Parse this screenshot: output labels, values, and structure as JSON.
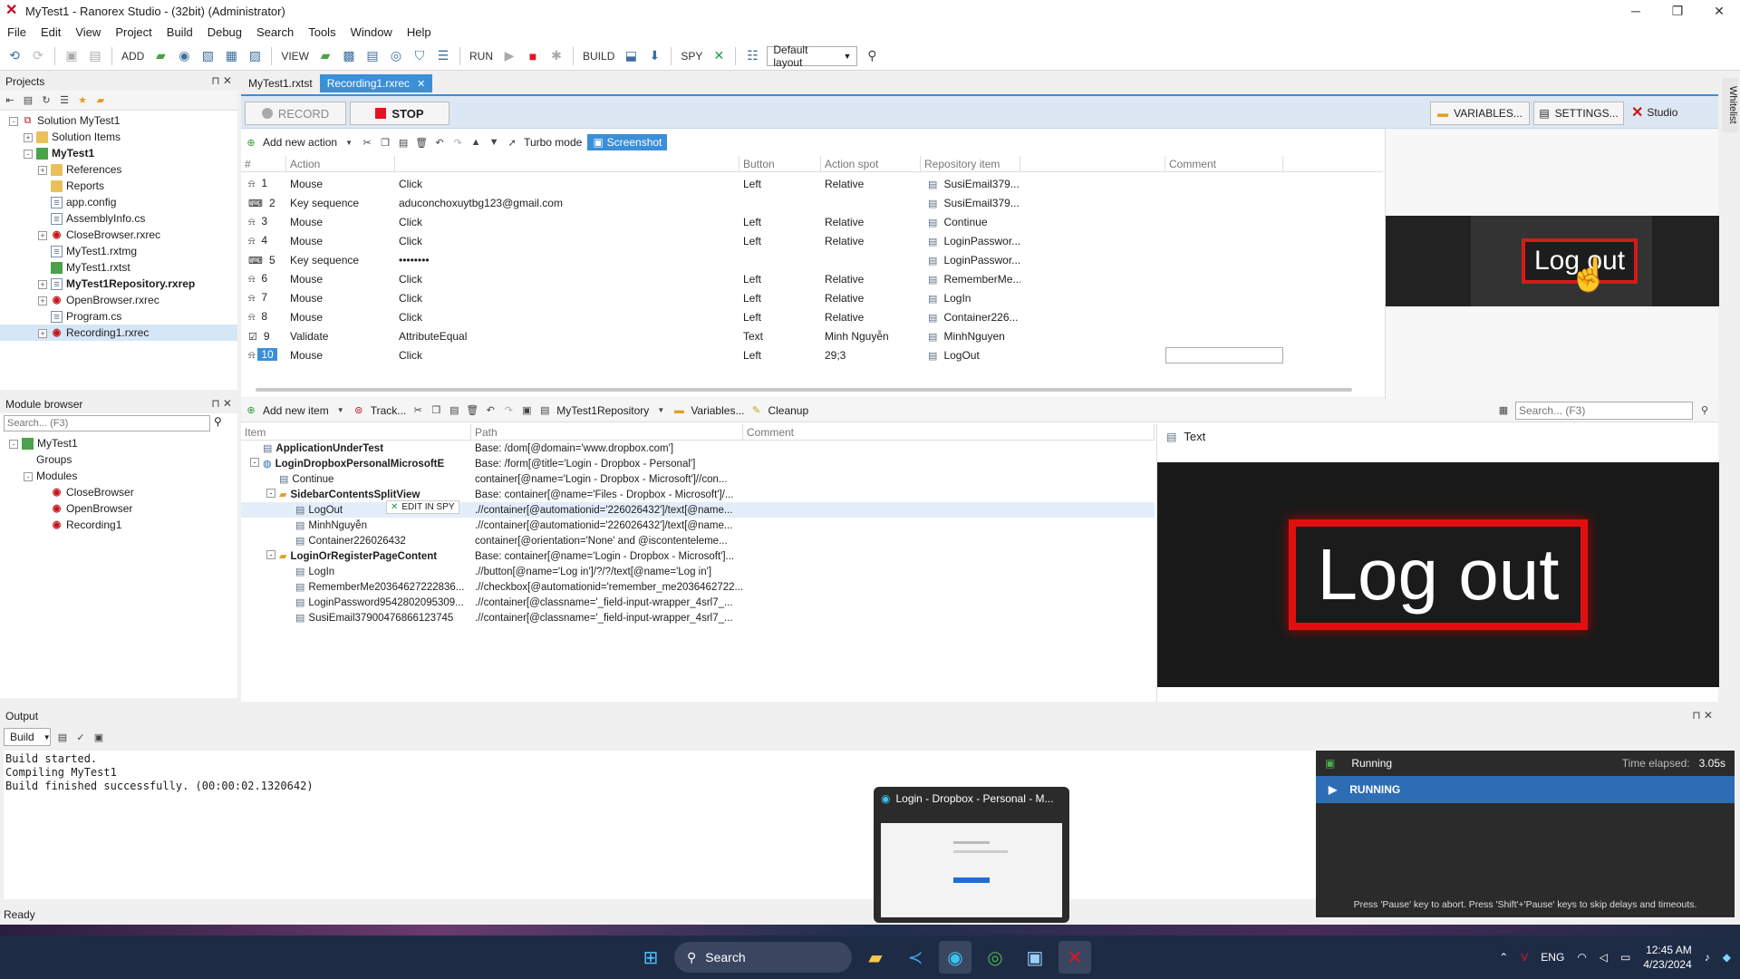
{
  "window": {
    "title": "MyTest1 - Ranorex Studio - (32bit) (Administrator)"
  },
  "menu": [
    "File",
    "Edit",
    "View",
    "Project",
    "Build",
    "Debug",
    "Search",
    "Tools",
    "Window",
    "Help"
  ],
  "toolbar": {
    "add": "ADD",
    "view": "VIEW",
    "run": "RUN",
    "build": "BUILD",
    "spy": "SPY",
    "layout": "Default layout"
  },
  "projects": {
    "title": "Projects",
    "items": [
      {
        "label": "Solution MyTest1",
        "indent": 0,
        "icon": "solution",
        "exp": "-"
      },
      {
        "label": "Solution Items",
        "indent": 1,
        "icon": "folder",
        "exp": "+"
      },
      {
        "label": "MyTest1",
        "indent": 1,
        "icon": "project",
        "exp": "-",
        "bold": true
      },
      {
        "label": "References",
        "indent": 2,
        "icon": "folder",
        "exp": "+"
      },
      {
        "label": "Reports",
        "indent": 2,
        "icon": "folder",
        "exp": ""
      },
      {
        "label": "app.config",
        "indent": 2,
        "icon": "file",
        "exp": ""
      },
      {
        "label": "AssemblyInfo.cs",
        "indent": 2,
        "icon": "file",
        "exp": ""
      },
      {
        "label": "CloseBrowser.rxrec",
        "indent": 2,
        "icon": "rec",
        "exp": "+"
      },
      {
        "label": "MyTest1.rxtmg",
        "indent": 2,
        "icon": "file",
        "exp": ""
      },
      {
        "label": "MyTest1.rxtst",
        "indent": 2,
        "icon": "project",
        "exp": ""
      },
      {
        "label": "MyTest1Repository.rxrep",
        "indent": 2,
        "icon": "file",
        "exp": "+",
        "bold": true
      },
      {
        "label": "OpenBrowser.rxrec",
        "indent": 2,
        "icon": "rec",
        "exp": "+"
      },
      {
        "label": "Program.cs",
        "indent": 2,
        "icon": "file",
        "exp": ""
      },
      {
        "label": "Recording1.rxrec",
        "indent": 2,
        "icon": "rec",
        "exp": "+",
        "selected": true
      }
    ]
  },
  "module_browser": {
    "title": "Module browser",
    "search_placeholder": "Search... (F3)",
    "items": [
      {
        "label": "MyTest1",
        "indent": 0,
        "icon": "project",
        "exp": "-"
      },
      {
        "label": "Groups",
        "indent": 1,
        "icon": "none",
        "exp": ""
      },
      {
        "label": "Modules",
        "indent": 1,
        "icon": "none",
        "exp": "-"
      },
      {
        "label": "CloseBrowser",
        "indent": 2,
        "icon": "rec",
        "exp": ""
      },
      {
        "label": "OpenBrowser",
        "indent": 2,
        "icon": "rec",
        "exp": ""
      },
      {
        "label": "Recording1",
        "indent": 2,
        "icon": "rec",
        "exp": ""
      }
    ]
  },
  "tabs": [
    {
      "label": "MyTest1.rxtst",
      "active": false
    },
    {
      "label": "Recording1.rxrec",
      "active": true
    }
  ],
  "recorder": {
    "record_label": "RECORD",
    "stop_label": "STOP",
    "variables_label": "VARIABLES...",
    "settings_label": "SETTINGS...",
    "studio_label": "Studio",
    "add_action": "Add new action",
    "turbo": "Turbo mode",
    "screenshot": "Screenshot",
    "columns": [
      "#",
      "Action",
      "",
      "Button",
      "Action spot",
      "Repository item",
      "",
      "Comment"
    ],
    "actions": [
      {
        "n": "1",
        "type": "Mouse",
        "action": "Click",
        "button": "Left",
        "spot": "Relative",
        "repo": "SusiEmail379..."
      },
      {
        "n": "2",
        "type": "Key sequence",
        "action": "aduconchoxuytbg123@gmail.com",
        "button": "",
        "spot": "",
        "repo": "SusiEmail379..."
      },
      {
        "n": "3",
        "type": "Mouse",
        "action": "Click",
        "button": "Left",
        "spot": "Relative",
        "repo": "Continue"
      },
      {
        "n": "4",
        "type": "Mouse",
        "action": "Click",
        "button": "Left",
        "spot": "Relative",
        "repo": "LoginPasswor..."
      },
      {
        "n": "5",
        "type": "Key sequence",
        "action": "••••••••",
        "button": "",
        "spot": "",
        "repo": "LoginPasswor..."
      },
      {
        "n": "6",
        "type": "Mouse",
        "action": "Click",
        "button": "Left",
        "spot": "Relative",
        "repo": "RememberMe..."
      },
      {
        "n": "7",
        "type": "Mouse",
        "action": "Click",
        "button": "Left",
        "spot": "Relative",
        "repo": "LogIn"
      },
      {
        "n": "8",
        "type": "Mouse",
        "action": "Click",
        "button": "Left",
        "spot": "Relative",
        "repo": "Container226..."
      },
      {
        "n": "9",
        "type": "Validate",
        "action": "AttributeEqual",
        "button": "Text",
        "spot": "Minh Nguyễn",
        "repo": "MinhNguyen"
      },
      {
        "n": "10",
        "type": "Mouse",
        "action": "Click",
        "button": "Left",
        "spot": "29;3",
        "repo": "LogOut",
        "selected": true
      }
    ],
    "preview_text": "Log out"
  },
  "repository": {
    "add_item": "Add new item",
    "track": "Track...",
    "repo_name": "MyTest1Repository",
    "variables": "Variables...",
    "cleanup": "Cleanup",
    "search_placeholder": "Search... (F3)",
    "preview_title": "Text",
    "preview_text": "Log out",
    "edit_in_spy": "EDIT IN SPY",
    "columns": [
      "Item",
      "Path",
      "Comment"
    ],
    "items": [
      {
        "label": "ApplicationUnderTest",
        "indent": 0,
        "bold": true,
        "exp": "",
        "path": "Base: /dom[@domain='www.dropbox.com']"
      },
      {
        "label": "LoginDropboxPersonalMicrosoftE",
        "indent": 0,
        "bold": true,
        "exp": "-",
        "path": "Base: /form[@title='Login - Dropbox - Personal']"
      },
      {
        "label": "Continue",
        "indent": 1,
        "exp": "",
        "path": "container[@name='Login - Dropbox - Microsoft']//con..."
      },
      {
        "label": "SidebarContentsSplitView",
        "indent": 1,
        "bold": true,
        "exp": "-",
        "path": "Base: container[@name='Files - Dropbox - Microsoft']/..."
      },
      {
        "label": "LogOut",
        "indent": 2,
        "exp": "",
        "path": ".//container[@automationid='226026432']/text[@name...",
        "selected": true
      },
      {
        "label": "MinhNguyễn",
        "indent": 2,
        "exp": "",
        "path": ".//container[@automationid='226026432']/text[@name..."
      },
      {
        "label": "Container226026432",
        "indent": 2,
        "exp": "",
        "path": "container[@orientation='None' and @iscontenteleme..."
      },
      {
        "label": "LoginOrRegisterPageContent",
        "indent": 1,
        "bold": true,
        "exp": "-",
        "path": "Base: container[@name='Login - Dropbox - Microsoft']..."
      },
      {
        "label": "LogIn",
        "indent": 2,
        "exp": "",
        "path": ".//button[@name='Log in']/?/?/text[@name='Log in']"
      },
      {
        "label": "RememberMe20364627222836...",
        "indent": 2,
        "exp": "",
        "path": ".//checkbox[@automationid='remember_me2036462722..."
      },
      {
        "label": "LoginPassword9542802095309...",
        "indent": 2,
        "exp": "",
        "path": ".//container[@classname='_field-input-wrapper_4srl7_..."
      },
      {
        "label": "SusiEmail37900476866123745",
        "indent": 2,
        "exp": "",
        "path": ".//container[@classname='_field-input-wrapper_4srl7_..."
      }
    ]
  },
  "output": {
    "title": "Output",
    "source": "Build",
    "lines": [
      "Build started.",
      "Compiling MyTest1",
      "Build finished successfully. (00:00:02.1320642)"
    ]
  },
  "status": "Ready",
  "thumbnail": {
    "title": "Login - Dropbox - Personal - M..."
  },
  "running": {
    "label": "Running",
    "elapsed_label": "Time elapsed:",
    "elapsed": "3.05s",
    "state": "RUNNING",
    "hint": "Press 'Pause' key to abort. Press 'Shift'+'Pause' keys to skip delays and timeouts."
  },
  "taskbar": {
    "search": "Search",
    "lang": "ENG",
    "time": "12:45 AM",
    "date": "4/23/2024"
  },
  "whitelist": "Whitelist",
  "colors": {
    "accent": "#3b8fd8",
    "running_bar": "#2d6db5",
    "record_red": "#e81123",
    "taskbar": "#1e2b45"
  }
}
